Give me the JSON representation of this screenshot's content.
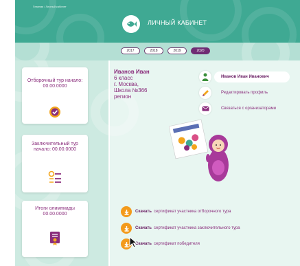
{
  "header": {
    "breadcrumb": "Главная / Личный кабинет",
    "title": "ЛИЧНЫЙ КАБИНЕТ",
    "logo_icon": "fish-logo-icon",
    "background_color": "#3fa993"
  },
  "years": [
    "2017",
    "2018",
    "2019",
    "2020"
  ],
  "active_year": "2020",
  "stages": [
    {
      "label": "Отборочный тур начало: 00.00.0000",
      "icon": "check-badge-icon"
    },
    {
      "label": "Заключительный тур начало: 00.00.0000",
      "icon": "trophy-list-icon"
    },
    {
      "label": "Итоги олимпиады 00.00.0000",
      "icon": "certificate-icon"
    }
  ],
  "student": {
    "name": "Иванов Иван",
    "grade": "6 класс",
    "city": "г. Москва,",
    "school": "Школа №366",
    "region": "регион"
  },
  "menu": {
    "full_name": "Иванов Иван Иванович",
    "edit_profile": "Редактировать профиль",
    "contact_organizers": "Связаться с организаторами"
  },
  "downloads": [
    {
      "action": "Скачать",
      "text": "сертификат участника отборочного тура"
    },
    {
      "action": "Скачать",
      "text": "сертификат участника заключительного тура"
    },
    {
      "action": "Скачать",
      "text": "сертификат победителя"
    }
  ],
  "colors": {
    "accent_purple": "#8a2d7c",
    "active_year": "#6f2c74",
    "download_orange": "#f39a1b",
    "content_background": "#cdeae1"
  }
}
